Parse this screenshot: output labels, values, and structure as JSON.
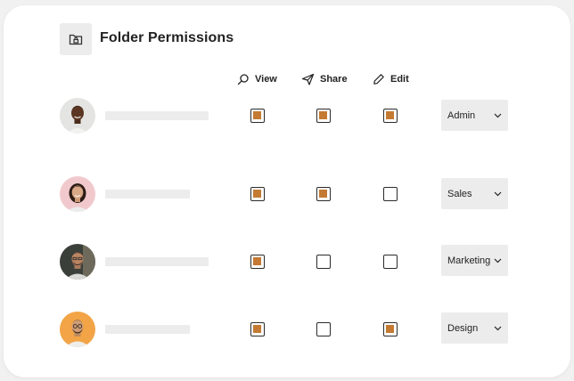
{
  "header": {
    "title": "Folder Permissions",
    "folder_icon": "folder-lock-icon"
  },
  "columns": [
    {
      "key": "view",
      "label": "View",
      "icon": "search-icon"
    },
    {
      "key": "share",
      "label": "Share",
      "icon": "send-icon"
    },
    {
      "key": "edit",
      "label": "Edit",
      "icon": "pencil-icon"
    }
  ],
  "users": [
    {
      "avatar": "avatar-photo",
      "permissions": {
        "view": true,
        "share": true,
        "edit": true
      },
      "role": "Admin"
    },
    {
      "avatar": "avatar-photo",
      "permissions": {
        "view": true,
        "share": true,
        "edit": false
      },
      "role": "Sales"
    },
    {
      "avatar": "avatar-photo",
      "permissions": {
        "view": true,
        "share": false,
        "edit": false
      },
      "role": "Marketing"
    },
    {
      "avatar": "avatar-photo",
      "permissions": {
        "view": true,
        "share": false,
        "edit": true
      },
      "role": "Design"
    }
  ],
  "role_dropdown_icon": "chevron-down-icon",
  "colors": {
    "checked": "#c47a32",
    "border": "#2b2b2b",
    "placeholder": "#ececec"
  }
}
